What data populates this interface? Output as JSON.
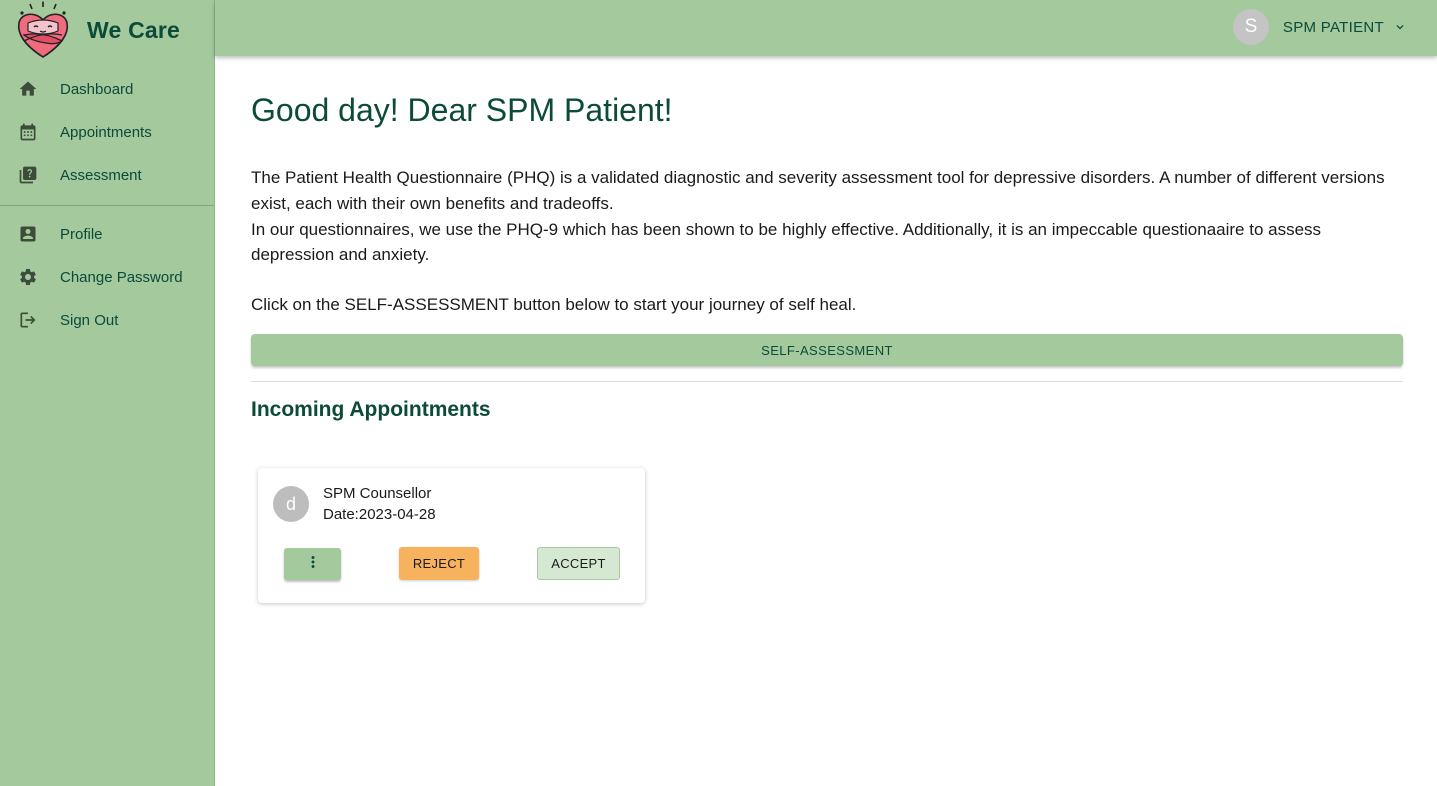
{
  "brand": {
    "name": "We Care"
  },
  "sidebar": {
    "items": [
      {
        "label": "Dashboard",
        "icon": "home-icon"
      },
      {
        "label": "Appointments",
        "icon": "calendar-icon"
      },
      {
        "label": "Assessment",
        "icon": "quiz-icon"
      },
      {
        "label": "Profile",
        "icon": "profile-icon"
      },
      {
        "label": "Change Password",
        "icon": "gear-icon"
      },
      {
        "label": "Sign Out",
        "icon": "logout-icon"
      }
    ]
  },
  "header": {
    "user": {
      "avatar_letter": "S",
      "name": "SPM PATIENT"
    }
  },
  "main": {
    "greeting": "Good day! Dear SPM Patient!",
    "intro_paragraphs": [
      "The Patient Health Questionnaire (PHQ) is a validated diagnostic and severity assessment tool for depressive disorders. A number of different versions exist, each with their own benefits and tradeoffs.",
      "In our questionnaires, we use the PHQ-9 which has been shown to be highly effective. Additionally, it is an impeccable questionaaire to assess depression and anxiety."
    ],
    "cta_text": "Click on the SELF-ASSESSMENT button below to start your journey of self heal.",
    "self_assessment_label": "SELF-ASSESSMENT",
    "section_title": "Incoming Appointments"
  },
  "appointments": [
    {
      "avatar_letter": "d",
      "counsellor": "SPM Counsellor",
      "date": "Date:2023-04-28",
      "reject_label": "REJECT",
      "accept_label": "ACCEPT"
    }
  ],
  "colors": {
    "sidebar_bg": "#a3c99c",
    "primary_text": "#0c4a3a",
    "reject_bg": "#f7b25e",
    "accept_bg": "#d5e8d1"
  }
}
